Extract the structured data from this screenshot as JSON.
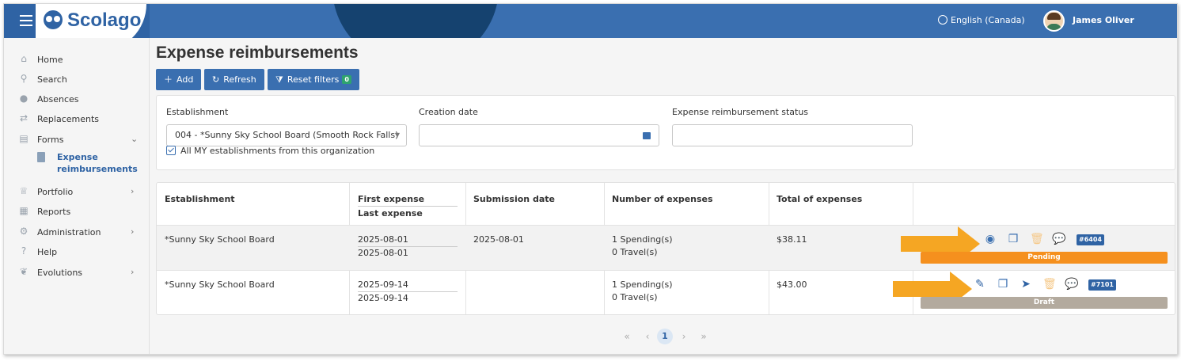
{
  "header": {
    "brand": "Scolago",
    "language": "English (Canada)",
    "user_name": "James Oliver"
  },
  "sidebar": {
    "items": [
      {
        "label": "Home",
        "icon": "home-icon"
      },
      {
        "label": "Search",
        "icon": "search-icon"
      },
      {
        "label": "Absences",
        "icon": "absences-icon"
      },
      {
        "label": "Replacements",
        "icon": "replacements-icon"
      },
      {
        "label": "Forms",
        "icon": "forms-icon"
      },
      {
        "label": "Portfolio",
        "icon": "trophy-icon"
      },
      {
        "label": "Reports",
        "icon": "reports-icon"
      },
      {
        "label": "Administration",
        "icon": "gear-icon"
      },
      {
        "label": "Help",
        "icon": "help-icon"
      },
      {
        "label": "Evolutions",
        "icon": "sprout-icon"
      }
    ],
    "sub_item": {
      "label_line1": "Expense",
      "label_line2": "reimbursements"
    }
  },
  "page": {
    "title": "Expense reimbursements",
    "toolbar": {
      "add_label": "Add",
      "refresh_label": "Refresh",
      "reset_label": "Reset filters",
      "reset_count": "0"
    }
  },
  "filters": {
    "establishment_label": "Establishment",
    "establishment_value": "004 - *Sunny Sky School Board (Smooth Rock Falls)",
    "creation_date_label": "Creation date",
    "creation_date_value": "",
    "status_label": "Expense reimbursement status",
    "status_value": "",
    "all_mine_label": "All MY establishments from this organization"
  },
  "table": {
    "headers": {
      "establishment": "Establishment",
      "first_expense": "First expense",
      "last_expense": "Last expense",
      "submission_date": "Submission date",
      "number_of_expenses": "Number of expenses",
      "total_of_expenses": "Total of expenses"
    },
    "rows": [
      {
        "establishment": "*Sunny Sky School Board",
        "first_expense": "2025-08-01",
        "last_expense": "2025-08-01",
        "submission_date": "2025-08-01",
        "spending": "1 Spending(s)",
        "travel": "0 Travel(s)",
        "total": "$38.11",
        "id": "#6404",
        "status": "Pending",
        "status_color": "#f5901e"
      },
      {
        "establishment": "*Sunny Sky School Board",
        "first_expense": "2025-09-14",
        "last_expense": "2025-09-14",
        "submission_date": "",
        "spending": "1 Spending(s)",
        "travel": "0 Travel(s)",
        "total": "$43.00",
        "id": "#7101",
        "status": "Draft",
        "status_color": "#b3aa9e"
      }
    ]
  },
  "pagination": {
    "current_page": "1"
  },
  "colors": {
    "primary": "#3a6fb0",
    "arrow": "#f5a623"
  }
}
